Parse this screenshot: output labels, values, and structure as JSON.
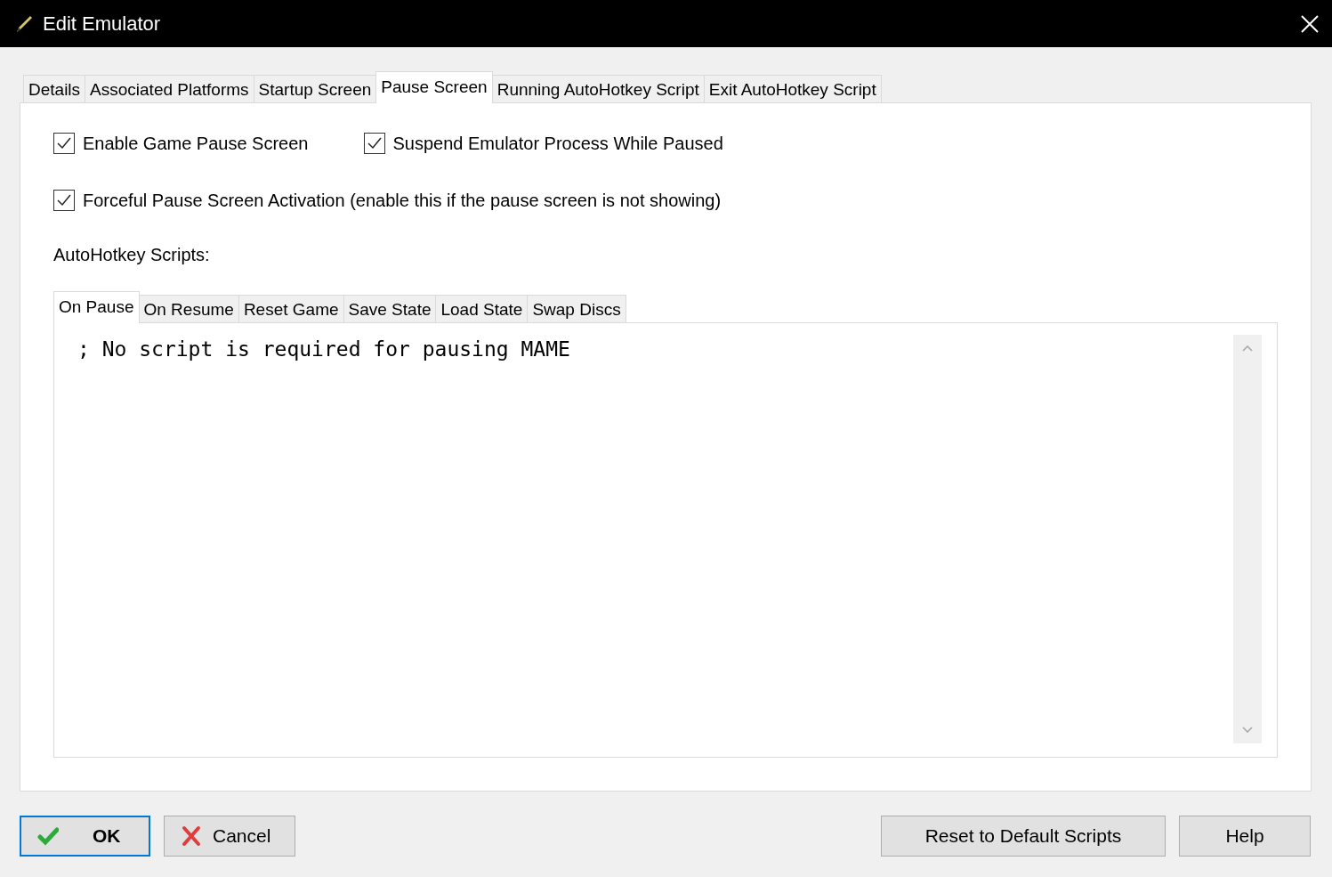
{
  "window": {
    "title": "Edit Emulator"
  },
  "tabs": [
    {
      "label": "Details",
      "selected": false
    },
    {
      "label": "Associated Platforms",
      "selected": false
    },
    {
      "label": "Startup Screen",
      "selected": false
    },
    {
      "label": "Pause Screen",
      "selected": true
    },
    {
      "label": "Running AutoHotkey Script",
      "selected": false
    },
    {
      "label": "Exit AutoHotkey Script",
      "selected": false
    }
  ],
  "checkbox_rows": [
    [
      {
        "label": "Enable Game Pause Screen",
        "checked": true
      },
      {
        "label": "Suspend Emulator Process While Paused",
        "checked": true
      }
    ],
    [
      {
        "label": "Forceful Pause Screen Activation (enable this if the pause screen is not showing)",
        "checked": true
      }
    ]
  ],
  "scripts_label": "AutoHotkey Scripts:",
  "script_tabs": [
    {
      "label": "On Pause",
      "selected": true
    },
    {
      "label": "On Resume",
      "selected": false
    },
    {
      "label": "Reset Game",
      "selected": false
    },
    {
      "label": "Save State",
      "selected": false
    },
    {
      "label": "Load State",
      "selected": false
    },
    {
      "label": "Swap Discs",
      "selected": false
    }
  ],
  "script_editor": {
    "value": "; No script is required for pausing MAME"
  },
  "buttons_left": [
    {
      "label": "OK",
      "kind": "ok"
    },
    {
      "label": "Cancel",
      "kind": "cancel"
    }
  ],
  "buttons_right": [
    {
      "label": "Reset to Default Scripts"
    },
    {
      "label": "Help"
    }
  ]
}
